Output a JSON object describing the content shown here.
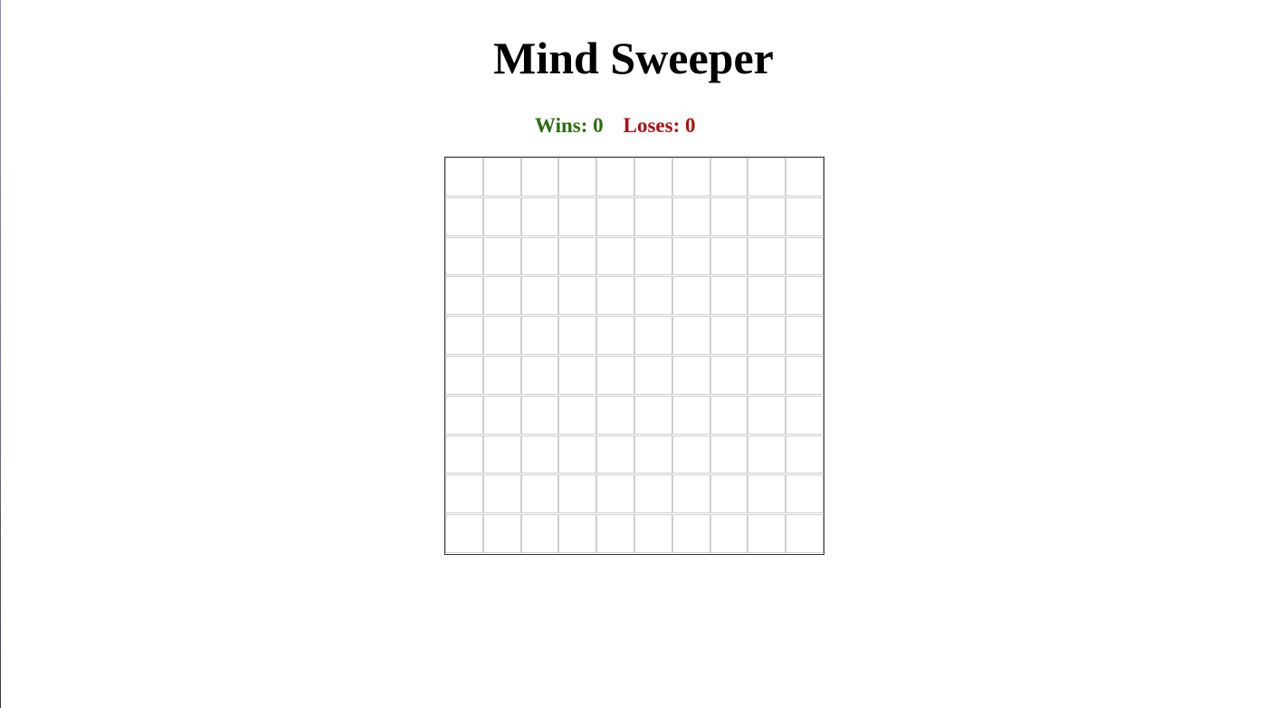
{
  "title": "Mind Sweeper",
  "score": {
    "wins_label": "Wins:",
    "wins": "0",
    "loses_label": "Loses:",
    "loses": "0"
  },
  "colors": {
    "wins": "#2e6b12",
    "loses": "#b01010"
  },
  "board": {
    "rows": 10,
    "cols": 10
  }
}
